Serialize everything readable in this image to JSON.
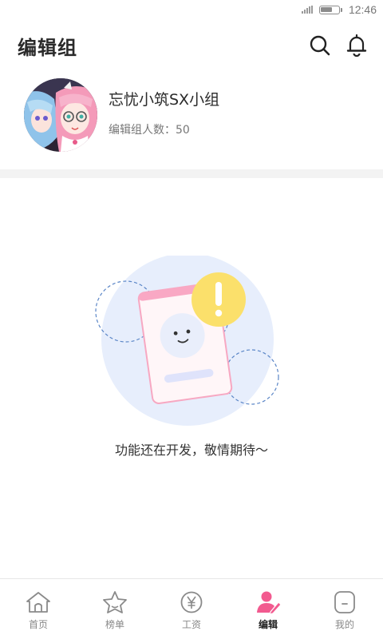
{
  "status_bar": {
    "time": "12:46"
  },
  "header": {
    "title": "编辑组"
  },
  "group": {
    "name": "忘忧小筑SX小组",
    "member_label": "编辑组人数：",
    "member_count": "50"
  },
  "empty_state": {
    "message": "功能还在开发，敬情期待～"
  },
  "tabs": [
    {
      "label": "首页",
      "icon": "home-icon",
      "active": false
    },
    {
      "label": "榜单",
      "icon": "star-icon",
      "active": false
    },
    {
      "label": "工资",
      "icon": "yen-icon",
      "active": false
    },
    {
      "label": "编辑",
      "icon": "editor-icon",
      "active": true
    },
    {
      "label": "我的",
      "icon": "profile-icon",
      "active": false
    }
  ],
  "colors": {
    "accent": "#f25a8f",
    "illustration_bg": "#e7eefc",
    "exclaim": "#fbe06b"
  }
}
